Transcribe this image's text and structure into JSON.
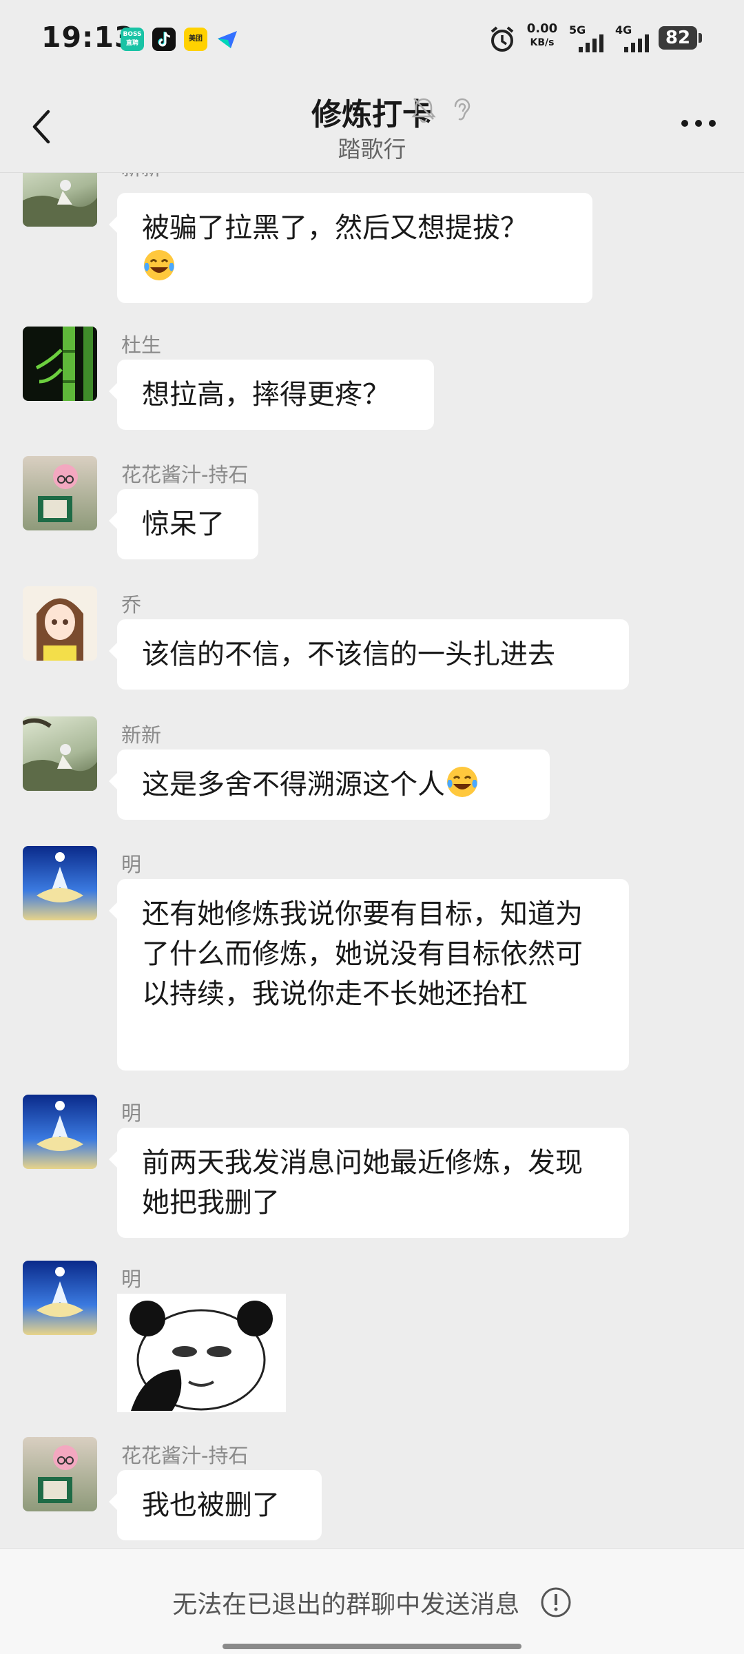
{
  "status_bar": {
    "time": "19:13",
    "app_icons": [
      "boss-zhipin-icon",
      "tiktok-icon",
      "meituan-icon",
      "feishu-icon"
    ],
    "boss_label": "BOSS\n直聘",
    "meituan_label": "美团",
    "net_speed_value": "0.00",
    "net_speed_unit": "KB/s",
    "signal_1": "5G",
    "signal_2": "4G",
    "battery": "82"
  },
  "header": {
    "title": "修炼打卡",
    "subtitle": "踏歌行",
    "icons": [
      "mute-bell-icon",
      "ear-icon"
    ]
  },
  "messages": [
    {
      "sender": "新新",
      "avatar": "landscape-avatar",
      "text": "被骗了拉黑了，然后又想提拔？",
      "emoji": "laughing-tears"
    },
    {
      "sender": "杜生",
      "avatar": "bamboo-avatar",
      "text": "想拉高，摔得更疼？"
    },
    {
      "sender": "花花酱汁-持石",
      "avatar": "reading-pig-avatar",
      "text": "惊呆了"
    },
    {
      "sender": "乔",
      "avatar": "anime-girl-avatar",
      "text": "该信的不信，不该信的一头扎进去"
    },
    {
      "sender": "新新",
      "avatar": "landscape-avatar",
      "text": "这是多舍不得溯源这个人",
      "emoji": "laughing-tears"
    },
    {
      "sender": "明",
      "avatar": "lotus-avatar",
      "text": "还有她修炼我说你要有目标，知道为了什么而修炼，她说没有目标依然可以持续，我说你走不长她还抬杠"
    },
    {
      "sender": "明",
      "avatar": "lotus-avatar",
      "text": "前两天我发消息问她最近修炼，发现她把我删了"
    },
    {
      "sender": "明",
      "avatar": "lotus-avatar",
      "sticker": "panda-facepalm-sticker"
    },
    {
      "sender": "花花酱汁-持石",
      "avatar": "reading-pig-avatar",
      "text": "我也被删了"
    }
  ],
  "bottom_bar": {
    "notice": "无法在已退出的群聊中发送消息"
  },
  "colors": {
    "background": "#ededed",
    "bubble": "#ffffff",
    "sender_name": "#8a8a8a"
  }
}
